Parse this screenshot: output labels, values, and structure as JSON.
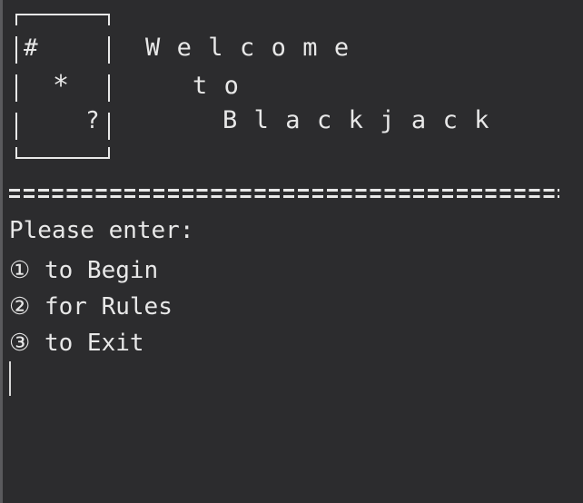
{
  "card": {
    "top_left_symbol": "#",
    "center_symbol": "*",
    "bottom_right_symbol": "?"
  },
  "title": {
    "line1": "Welcome",
    "line2": "to",
    "line3": "Blackjack"
  },
  "separator": "======================================",
  "menu": {
    "prompt": "Please enter:",
    "options": [
      "① to Begin",
      "② for Rules",
      "③ to Exit"
    ]
  },
  "colors": {
    "background": "#2c2c2e",
    "foreground": "#e8e8e8"
  }
}
